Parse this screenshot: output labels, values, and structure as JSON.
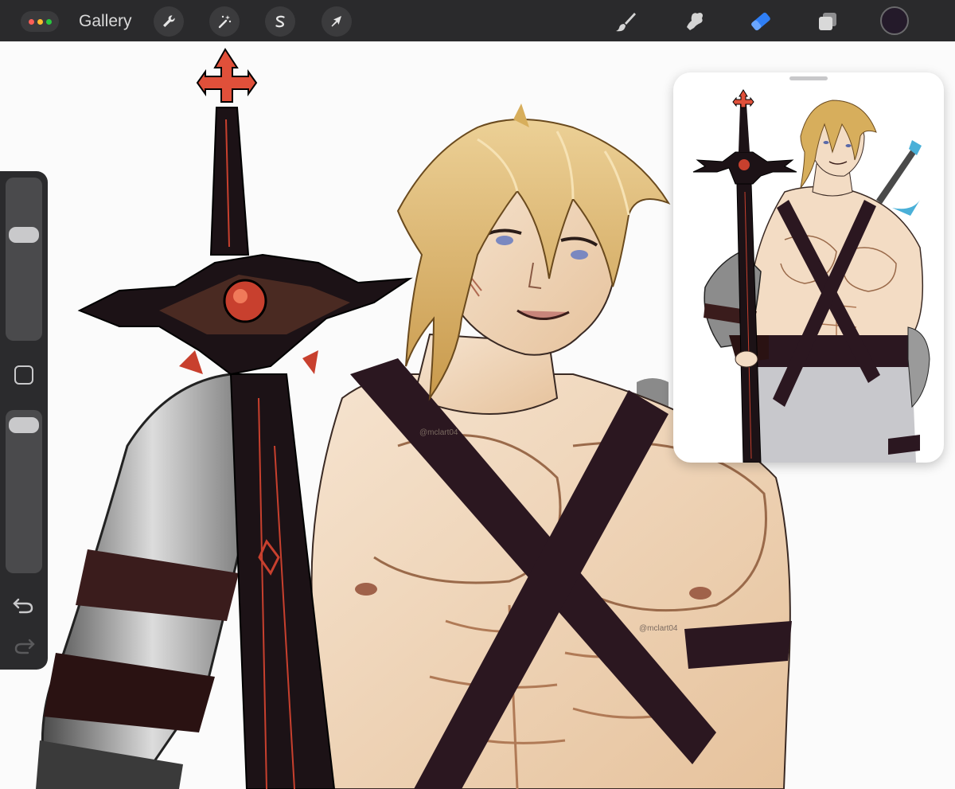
{
  "toolbar": {
    "gallery_label": "Gallery",
    "menu_dots": [
      "#ff5f57",
      "#febc2e",
      "#28c840"
    ],
    "left_tools": [
      {
        "name": "actions",
        "icon": "wrench-icon"
      },
      {
        "name": "adjustments",
        "icon": "magic-wand-icon"
      },
      {
        "name": "selection",
        "icon": "selection-s-icon"
      },
      {
        "name": "transform",
        "icon": "arrow-cursor-icon"
      }
    ],
    "right_tools": [
      {
        "name": "brush",
        "icon": "brush-icon",
        "active": false
      },
      {
        "name": "smudge",
        "icon": "smudge-icon",
        "active": false
      },
      {
        "name": "eraser",
        "icon": "eraser-icon",
        "active": true
      },
      {
        "name": "layers",
        "icon": "layers-icon",
        "active": false
      }
    ],
    "current_color": "#241a2a",
    "active_tool_color": "#2f7ff6"
  },
  "sidebar": {
    "brush_size_level": 0.67,
    "opacity_level": 0.97,
    "icons": [
      "modify-square-icon",
      "undo-icon",
      "redo-icon"
    ]
  },
  "canvas": {
    "watermark_text": "@mclart04",
    "artwork": "blond-hair-warrior-with-greatsword"
  },
  "reference_panel": {
    "artwork": "full-figure-reference"
  },
  "palette": {
    "sword_dark": "#1c1216",
    "sword_red": "#c8402e",
    "skin": "#f3dcc4",
    "skin_shade": "#d8aa82",
    "hair": "#d7ae5c",
    "hair_light": "#ecd096",
    "strap": "#2b1720",
    "armor": "#8c8c8c"
  }
}
